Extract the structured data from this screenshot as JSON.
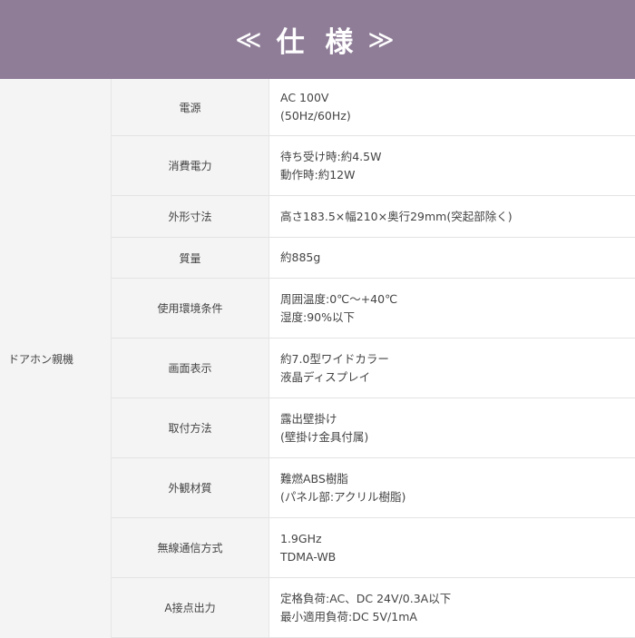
{
  "header": {
    "title": "仕 様",
    "left_mark": "≪",
    "right_mark": "≫"
  },
  "group_label": "ドアホン親機",
  "rows": [
    {
      "label": "電源",
      "lines": [
        "AC 100V",
        "(50Hz/60Hz)"
      ]
    },
    {
      "label": "消費電力",
      "lines": [
        "待ち受け時:約4.5W",
        "動作時:約12W"
      ]
    },
    {
      "label": "外形寸法",
      "lines": [
        "高さ183.5×幅210×奥行29mm(突起部除く)"
      ]
    },
    {
      "label": "質量",
      "lines": [
        "約885g"
      ]
    },
    {
      "label": "使用環境条件",
      "lines": [
        "周囲温度:0℃～+40℃",
        "湿度:90%以下"
      ]
    },
    {
      "label": "画面表示",
      "lines": [
        "約7.0型ワイドカラー",
        "液晶ディスプレイ"
      ]
    },
    {
      "label": "取付方法",
      "lines": [
        "露出壁掛け",
        "(壁掛け金具付属)"
      ]
    },
    {
      "label": "外観材質",
      "lines": [
        "難燃ABS樹脂",
        "(パネル部:アクリル樹脂)"
      ]
    },
    {
      "label": "無線通信方式",
      "lines": [
        "1.9GHz",
        "TDMA-WB"
      ]
    },
    {
      "label": "A接点出力",
      "lines": [
        "定格負荷:AC、DC 24V/0.3A以下",
        "最小適用負荷:DC 5V/1mA"
      ]
    }
  ]
}
